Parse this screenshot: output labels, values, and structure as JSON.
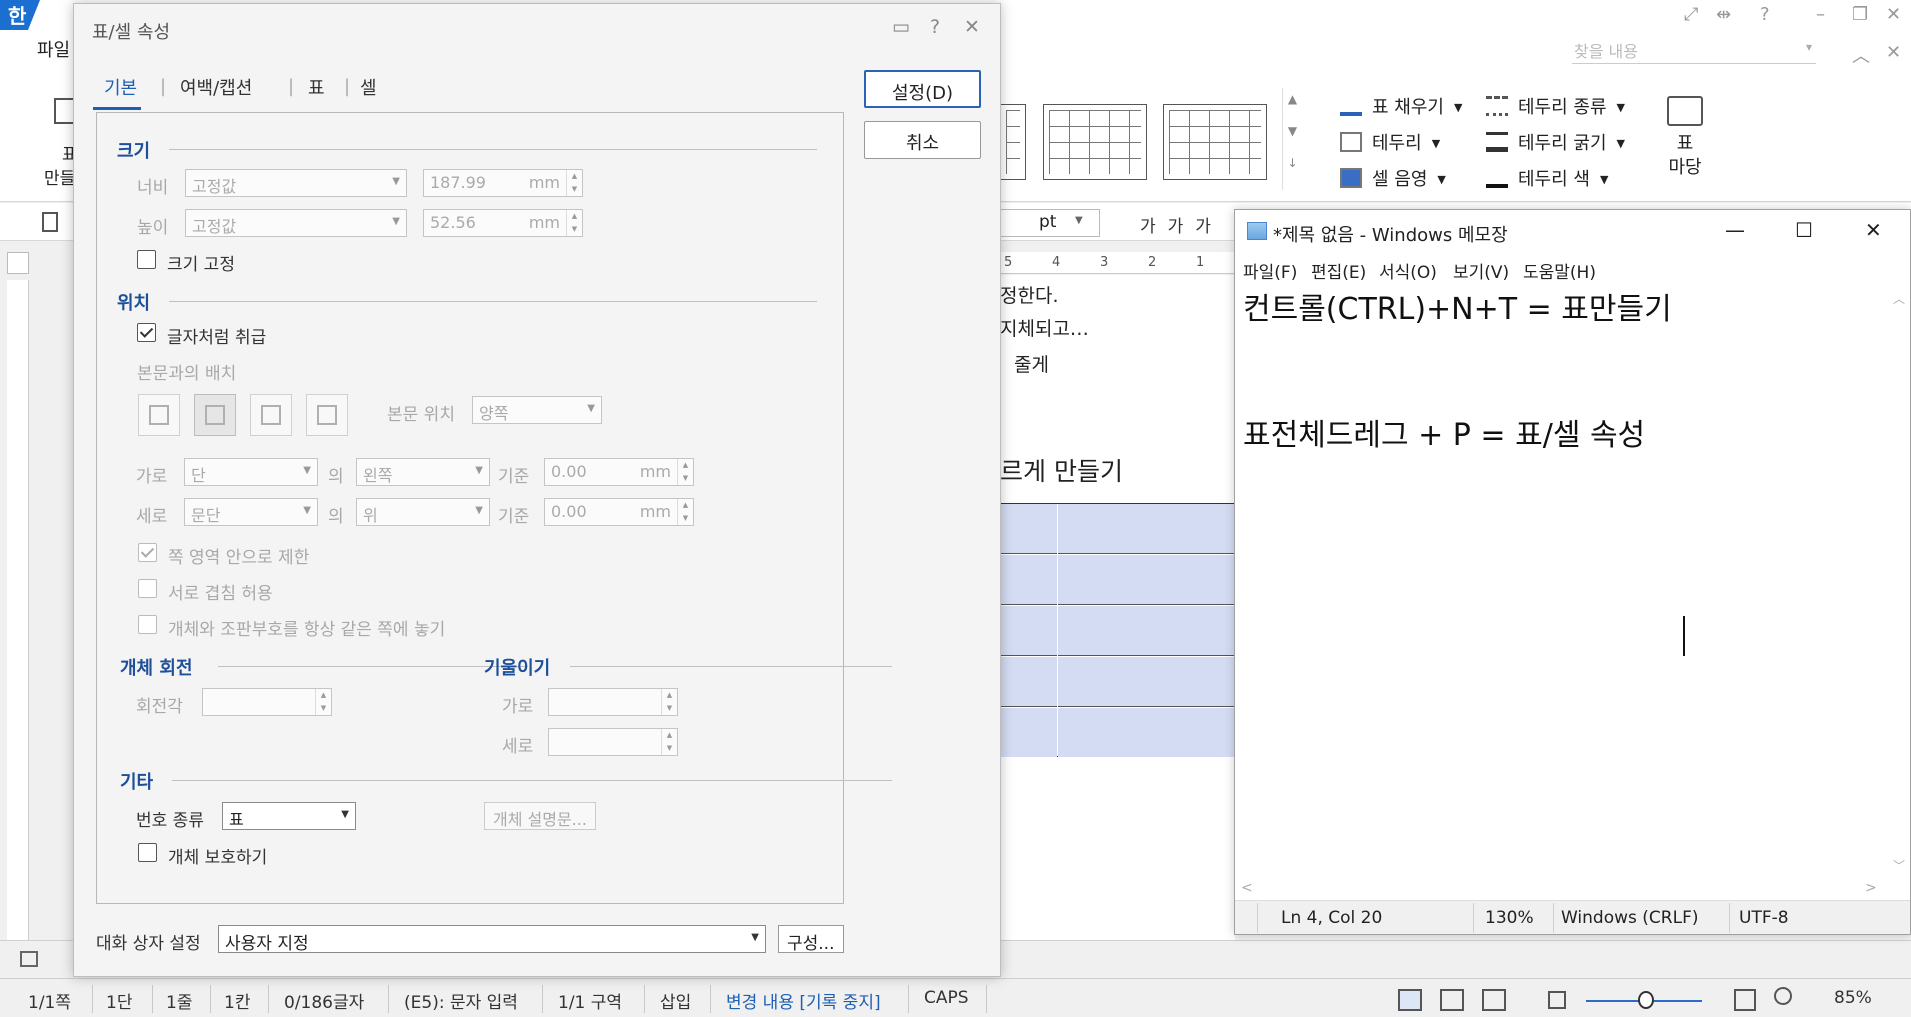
{
  "app": {
    "logo": "한",
    "menu_file": "파일",
    "find_placeholder": "찾을 내용",
    "ribbon_left_items": [
      "표",
      "만들"
    ],
    "ribbon": {
      "fill": "표 채우기",
      "border": "테두리",
      "shade": "셀 음영",
      "border_type": "테두리 종류",
      "border_width": "테두리 굵기",
      "border_color": "테두리 색",
      "madang_line1": "표",
      "madang_line2": "마당"
    },
    "pt_unit": "pt",
    "fmt_glyphs": "가가가",
    "ruler_labels": [
      "5",
      "4",
      "3",
      "2",
      "1"
    ],
    "doc_lines": [
      "정한다.",
      "지체되고…",
      "줄게"
    ],
    "doc_heading": "르게 만들기",
    "status": {
      "page": "1/1쪽",
      "column": "1단",
      "line": "1줄",
      "cell": "1칸",
      "chars": "0/186글자",
      "mode": "(E5): 문자 입력",
      "section": "1/1 구역",
      "insert": "삽입",
      "track": "변경 내용 [기록 중지]",
      "caps": "CAPS",
      "zoom": "85%"
    }
  },
  "dialog": {
    "title": "표/셀 속성",
    "tabs": [
      "기본",
      "여백/캡션",
      "표",
      "셀"
    ],
    "ok_label": "설정(D)",
    "cancel_label": "취소",
    "size": {
      "heading": "크기",
      "width_label": "너비",
      "width_mode": "고정값",
      "width_value": "187.99",
      "height_label": "높이",
      "height_mode": "고정값",
      "height_value": "52.56",
      "unit": "mm",
      "lock_label": "크기 고정"
    },
    "position": {
      "heading": "위치",
      "treat_as_char": "글자처럼 취급",
      "body_layout": "본문과의 배치",
      "body_pos_label": "본문 위치",
      "body_pos_value": "양쪽",
      "horiz_label": "가로",
      "horiz_ref": "단",
      "of": "의",
      "horiz_align": "왼쪽",
      "base": "기준",
      "horiz_offset": "0.00",
      "vert_label": "세로",
      "vert_ref": "문단",
      "vert_align": "위",
      "vert_offset": "0.00",
      "unit": "mm",
      "limit_page": "쪽 영역 안으로 제한",
      "allow_overlap": "서로 겹침 허용",
      "same_page": "개체와 조판부호를 항상 같은 쪽에 놓기"
    },
    "rotation": {
      "heading": "개체 회전",
      "angle_label": "회전각"
    },
    "skew": {
      "heading": "기울이기",
      "horiz_label": "가로",
      "vert_label": "세로"
    },
    "etc": {
      "heading": "기타",
      "number_type_label": "번호 종류",
      "number_type_value": "표",
      "description_button": "개체 설명문...",
      "protect_label": "개체 보호하기"
    },
    "dialog_setting_label": "대화 상자 설정",
    "dialog_setting_value": "사용자 지정",
    "configure_button": "구성..."
  },
  "notepad": {
    "title": "*제목 없음 - Windows 메모장",
    "menu": [
      "파일(F)",
      "편집(E)",
      "서식(O)",
      "보기(V)",
      "도움말(H)"
    ],
    "lines": [
      "컨트롤(CTRL)+N+T = 표만들기",
      "",
      "",
      "표전체드레그 + P = 표/셀 속성"
    ],
    "status": {
      "position": "Ln 4, Col 20",
      "zoom": "130%",
      "line_ending": "Windows (CRLF)",
      "encoding": "UTF-8"
    }
  }
}
